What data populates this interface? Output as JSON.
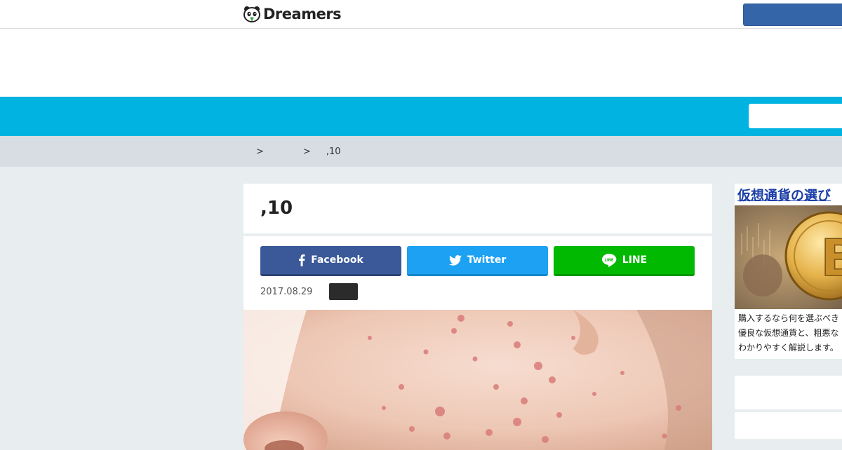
{
  "header": {
    "logo_text": "Dreamers",
    "button_label": ""
  },
  "nav": {
    "search_placeholder": ""
  },
  "breadcrumb": {
    "sep1": ">",
    "sep2": ">",
    "current": ",10"
  },
  "article": {
    "title": ",10",
    "date": "2017.08.29",
    "category": "",
    "share": {
      "facebook_label": "Facebook",
      "twitter_label": "Twitter",
      "line_label": "LINE"
    }
  },
  "sidebar": {
    "ad_title": "仮想通貨の選び",
    "ad_lines": [
      "購入するなら何を選ぶべき",
      "優良な仮想通貨と、粗悪な",
      "わかりやすく解説します。"
    ]
  },
  "colors": {
    "nav": "#00b3e0",
    "facebook": "#3b5998",
    "twitter": "#1da1f2",
    "line": "#00b900",
    "header_button": "#3465a8"
  },
  "icons": {
    "logo": "panda-icon",
    "facebook": "facebook-icon",
    "twitter": "twitter-bird-icon",
    "line": "line-icon"
  }
}
